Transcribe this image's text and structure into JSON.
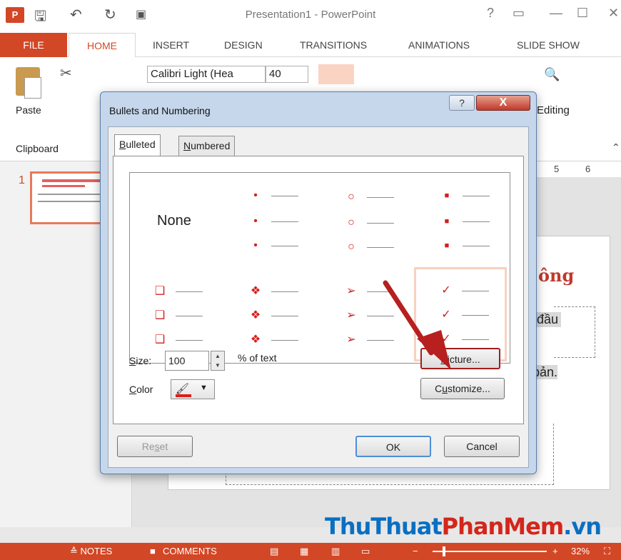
{
  "window": {
    "title": "Presentation1 - PowerPoint",
    "app_badge": "P",
    "help_glyph": "?"
  },
  "ribbon_tabs": [
    "FILE",
    "HOME",
    "INSERT",
    "DESIGN",
    "TRANSITIONS",
    "ANIMATIONS",
    "SLIDE SHOW"
  ],
  "ribbon": {
    "paste_label": "Paste",
    "clipboard_label": "Clipboard",
    "font_name": "Calibri Light (Hea",
    "font_size": "40",
    "editing_label": "Editing"
  },
  "slides_pane": {
    "slide_number": "1"
  },
  "ruler": {
    "ticks": [
      "5",
      "6"
    ]
  },
  "slide": {
    "title_fragment": "ông",
    "text1": "đầu",
    "text2": "bản."
  },
  "dialog": {
    "title": "Bullets and Numbering",
    "help_glyph": "?",
    "close_glyph": "X",
    "tabs": [
      {
        "id": "bulleted",
        "label": "Bulleted",
        "key": "B",
        "rest": "ulleted"
      },
      {
        "id": "numbered",
        "label": "Numbered",
        "key": "N",
        "rest": "umbered"
      }
    ],
    "gallery": {
      "none_label": "None",
      "glyphs": [
        "•",
        "○",
        "■",
        "❑",
        "❖",
        "➢",
        "✓"
      ]
    },
    "size_label_key": "S",
    "size_label_rest": "ize:",
    "size_value": "100",
    "size_unit": "% of text",
    "color_label_key": "C",
    "color_label_rest": "olor",
    "picture_button": {
      "key": "P",
      "rest": "icture..."
    },
    "customize_button": {
      "pre": "C",
      "key": "u",
      "rest": "stomize..."
    },
    "reset_button": {
      "pre": "Re",
      "key": "s",
      "rest": "et"
    },
    "ok_button": "OK",
    "cancel_button": "Cancel"
  },
  "status_bar": {
    "notes": "≙ NOTES",
    "comments": "COMMENTS",
    "zoom": "32%"
  },
  "watermark": {
    "part1": "ThuThuat",
    "part2": "PhanMem",
    "part3": ".vn"
  },
  "colors": {
    "accent": "#d24726",
    "bullet_red": "#d31f1f",
    "highlight_border": "#a31d1d",
    "arrow": "#b81f1f"
  }
}
